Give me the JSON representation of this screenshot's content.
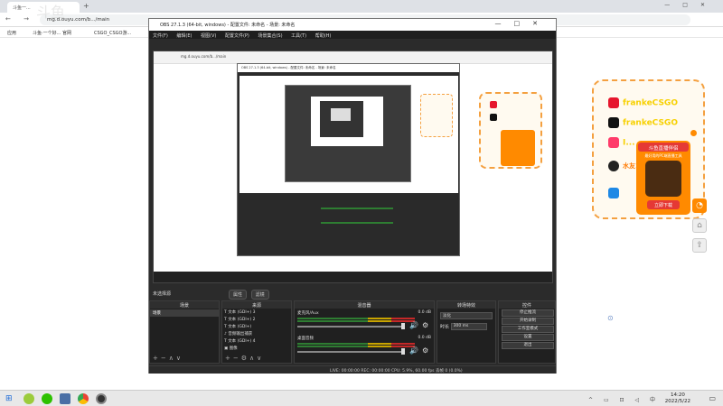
{
  "browser": {
    "tab_title": "斗鱼一...",
    "url": "mg.d.ouyu.com/b.../main",
    "bookmarks": [
      "应用",
      "斗鱼·一个好... 官网",
      "CSGO_CSGO游..."
    ],
    "watermark": "斗鱼"
  },
  "social": {
    "weibo": "frankeCSGO",
    "douyin": "frankeCSGO",
    "tag": "I...",
    "fan": "水友1群  ...6593752",
    "card_title": "斗鱼直播伴侣",
    "card_sub": "最好用的PC端直播工具",
    "card_btn": "立即下载",
    "colors": {
      "accent": "#f7d000",
      "border": "#f4a040",
      "card": "#ff8a00",
      "red": "#e53935"
    }
  },
  "obs": {
    "title": "OBS 27.1.3 (64-bit, windows) - 配置文件: 未命名 - 场景: 未命名",
    "menu": [
      "文件(F)",
      "编辑(E)",
      "视图(V)",
      "配置文件(P)",
      "场景集合(S)",
      "工具(T)",
      "帮助(H)"
    ],
    "nested_title": "OBS 27.1.3 (64-bit, windows) - 配置文件: 未命名 - 场景: 未命名",
    "status_scene": "未选择源",
    "status_btns": [
      "属性",
      "滤镜"
    ],
    "docks": {
      "scenes": {
        "title": "场景",
        "items": [
          "场景"
        ]
      },
      "sources": {
        "title": "来源",
        "items": [
          "文本 (GDI+) 3",
          "文本 (GDI+) 2",
          "文本 (GDI+)",
          "音频输出捕获",
          "文本 (GDI+) 4",
          "图像"
        ]
      },
      "mixer": {
        "title": "混音器",
        "channels": [
          {
            "name": "麦克风/Aux",
            "db": "0.0 dB"
          },
          {
            "name": "桌面音频",
            "db": "0.0 dB"
          }
        ]
      },
      "transitions": {
        "title": "转场特效",
        "type": "淡化",
        "duration_label": "时长",
        "duration": "300 ms"
      },
      "controls": {
        "title": "控件",
        "buttons": [
          "停止推流",
          "开始录制",
          "工作室模式",
          "设置",
          "退出"
        ]
      }
    },
    "statusbar": "LIVE: 00:00:00   REC: 00:00:00   CPU: 5.9%, 60.00 fps   丢帧 0 (0.0%)"
  },
  "taskbar": {
    "time": "14:20",
    "date": "2022/5/22"
  }
}
